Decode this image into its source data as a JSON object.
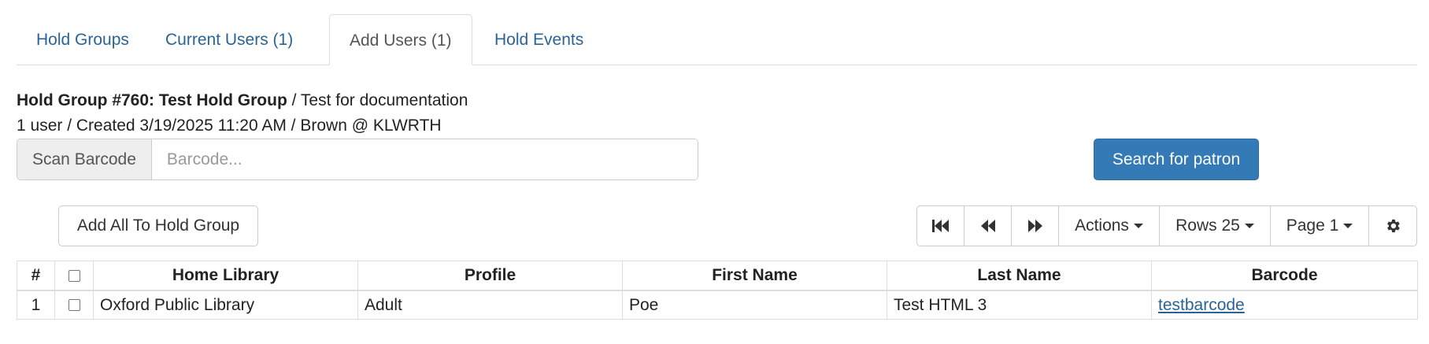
{
  "tabs": [
    {
      "label": "Hold Groups"
    },
    {
      "label": "Current Users (1)"
    },
    {
      "label": "Add Users (1)"
    },
    {
      "label": "Hold Events"
    }
  ],
  "header": {
    "group_title": "Hold Group #760: Test Hold Group",
    "group_description": " / Test for documentation",
    "meta": "1 user / Created 3/19/2025 11:20 AM / Brown @ KLWRTH"
  },
  "barcode": {
    "addon_label": "Scan Barcode",
    "placeholder": "Barcode...",
    "value": ""
  },
  "search_button": "Search for patron",
  "add_all_button": "Add All To Hold Group",
  "toolbar": {
    "first_icon": "first-page-icon",
    "prev_icon": "previous-page-icon",
    "next_icon": "next-page-icon",
    "actions": "Actions",
    "rows": "Rows 25",
    "page": "Page 1",
    "settings_icon": "gear-icon"
  },
  "grid": {
    "columns": [
      "#",
      "",
      "Home Library",
      "Profile",
      "First Name",
      "Last Name",
      "Barcode"
    ],
    "rows": [
      {
        "num": "1",
        "home_library": "Oxford Public Library",
        "profile": "Adult",
        "first_name": "Poe",
        "last_name": "Test HTML 3",
        "barcode": "testbarcode"
      }
    ]
  },
  "colors": {
    "link": "#2a6496",
    "primary": "#337ab7",
    "border": "#dddddd"
  }
}
